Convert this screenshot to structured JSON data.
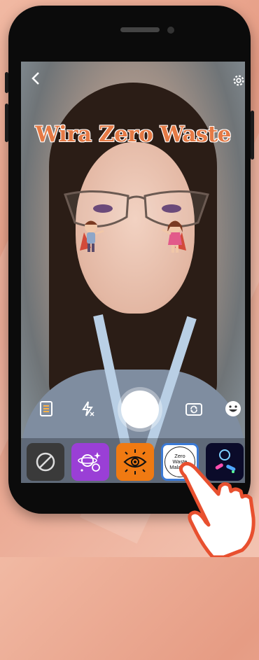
{
  "filter": {
    "title": "Wira Zero Waste"
  },
  "camera_toolbar": {
    "back_icon": "chevron-left-icon",
    "settings_icon": "gear-icon",
    "gallery_icon": "gallery-icon",
    "flash_icon": "flash-off-icon",
    "flip_icon": "camera-flip-icon",
    "emoji_icon": "smiley-icon"
  },
  "effects_tray": {
    "items": [
      {
        "name": "no-effect",
        "icon": "slash-circle-icon"
      },
      {
        "name": "sparkle-planets",
        "icon": "planet-sparkle-icon"
      },
      {
        "name": "eye-sun",
        "icon": "eye-icon"
      },
      {
        "name": "zero-waste-malaysia",
        "lines": [
          "Zero",
          "Waste",
          "Malaysia"
        ]
      },
      {
        "name": "neon-shapes",
        "icon": "neon-shapes-icon"
      }
    ]
  },
  "colors": {
    "title_orange": "#e57a45",
    "selected_border": "#3b7ad6",
    "purple_tile": "#9a3fd6",
    "orange_tile": "#f07a12"
  }
}
